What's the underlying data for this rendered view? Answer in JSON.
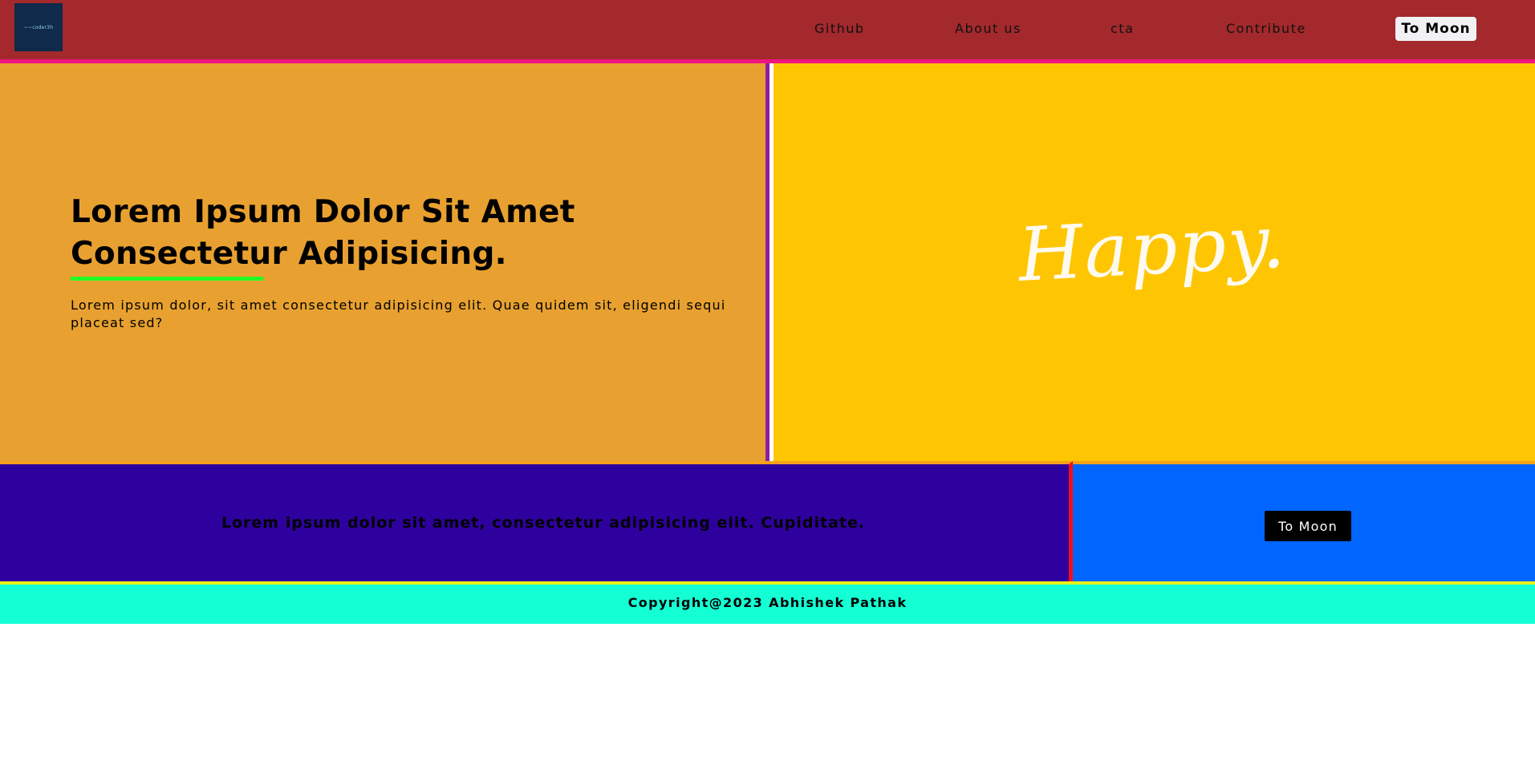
{
  "header": {
    "logo_text": "~~coder3h",
    "nav": [
      {
        "label": "Github"
      },
      {
        "label": "About us"
      },
      {
        "label": "cta"
      },
      {
        "label": "Contribute"
      }
    ],
    "cta_label": "To Moon"
  },
  "hero": {
    "title": "Lorem Ipsum Dolor Sit Amet Consectetur Adipisicing.",
    "subtitle": "Lorem ipsum dolor, sit amet consectetur adipisicing elit. Quae quidem sit, eligendi sequi placeat sed?",
    "image_text": "Happy."
  },
  "cta": {
    "text": "Lorem ipsum dolor sit amet, consectetur adipisicing elit. Cupiditate.",
    "button_label": "To Moon"
  },
  "footer": {
    "copyright": "Copyright@2023 Abhishek Pathak"
  },
  "colors": {
    "header_bg": "#a3292c",
    "header_border": "#f01680",
    "hero_left_bg": "#e8a130",
    "hero_divider": "#8a1fa0",
    "hero_right_bg": "#fec602",
    "underline": "#22ff22",
    "cta_left_bg": "#2e019e",
    "cta_divider": "#f50d1d",
    "cta_right_bg": "#0166ff",
    "footer_bg": "#15ffd4",
    "footer_border": "#e9f219"
  }
}
